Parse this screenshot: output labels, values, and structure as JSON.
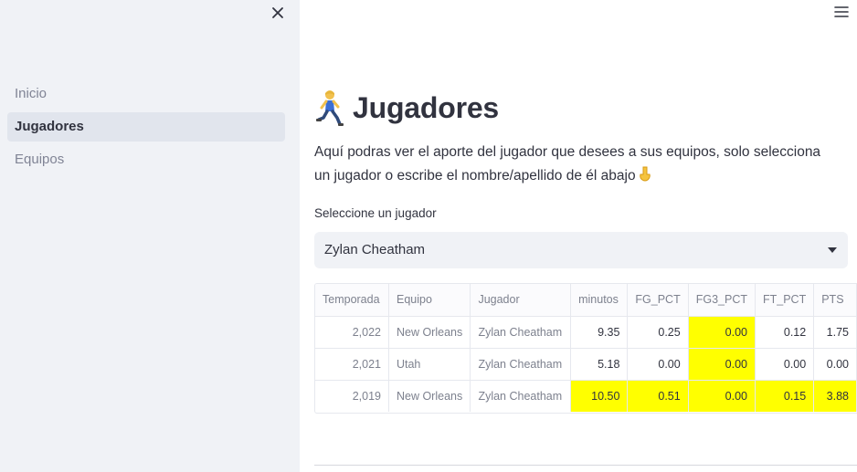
{
  "sidebar": {
    "close_icon": "close-icon",
    "items": [
      {
        "label": "Inicio",
        "active": false
      },
      {
        "label": "Jugadores",
        "active": true
      },
      {
        "label": "Equipos",
        "active": false
      }
    ]
  },
  "header": {
    "menu_icon": "hamburger-menu-icon"
  },
  "main": {
    "title_icon": "person-running-emoji",
    "title": "Jugadores",
    "intro": "Aquí podras ver el aporte del jugador que desees a sus equipos, solo selecciona un jugador o escribe el nombre/apellido de él abajo",
    "intro_icon": "pointing-down-emoji",
    "select_label": "Seleccione un jugador",
    "select_value": "Zylan Cheatham"
  },
  "table": {
    "columns": [
      "Temporada",
      "Equipo",
      "Jugador",
      "minutos",
      "FG_PCT",
      "FG3_PCT",
      "FT_PCT",
      "PTS"
    ],
    "rows": [
      {
        "temporada": "2,022",
        "equipo": "New Orleans",
        "jugador": "Zylan Cheatham",
        "minutos": "9.35",
        "fg_pct": "0.25",
        "fg3_pct": "0.00",
        "ft_pct": "0.12",
        "pts": "1.75"
      },
      {
        "temporada": "2,021",
        "equipo": "Utah",
        "jugador": "Zylan Cheatham",
        "minutos": "5.18",
        "fg_pct": "0.00",
        "fg3_pct": "0.00",
        "ft_pct": "0.00",
        "pts": "0.00"
      },
      {
        "temporada": "2,019",
        "equipo": "New Orleans",
        "jugador": "Zylan Cheatham",
        "minutos": "10.50",
        "fg_pct": "0.51",
        "fg3_pct": "0.00",
        "ft_pct": "0.15",
        "pts": "3.88"
      }
    ],
    "highlight_color": "#ffff00"
  },
  "colors": {
    "sidebar_bg": "#f0f2f6",
    "active_item_bg": "#e1e5ed",
    "text": "#31333f",
    "muted_text": "#808495"
  }
}
